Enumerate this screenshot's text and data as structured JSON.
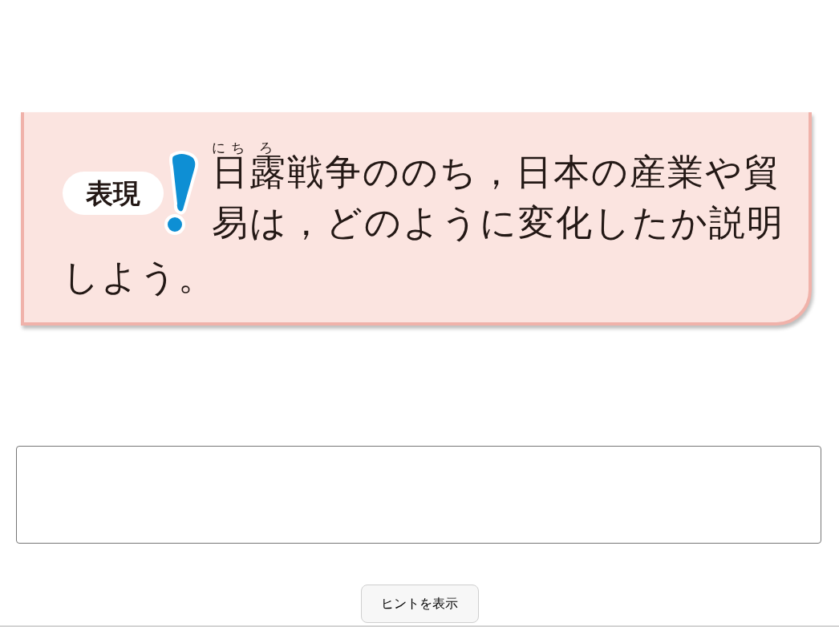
{
  "question": {
    "label": "表現",
    "lines": [
      [
        {
          "text": "日",
          "ruby": "にち"
        },
        {
          "text": "露",
          "ruby": "ろ"
        },
        {
          "text": "戦争ののち，日本の産業や貿"
        }
      ],
      [
        {
          "text": "易は，どのように変化したか説明"
        }
      ],
      [
        {
          "text": "しよう。"
        }
      ]
    ]
  },
  "hint_button": {
    "label": "ヒントを表示"
  }
}
